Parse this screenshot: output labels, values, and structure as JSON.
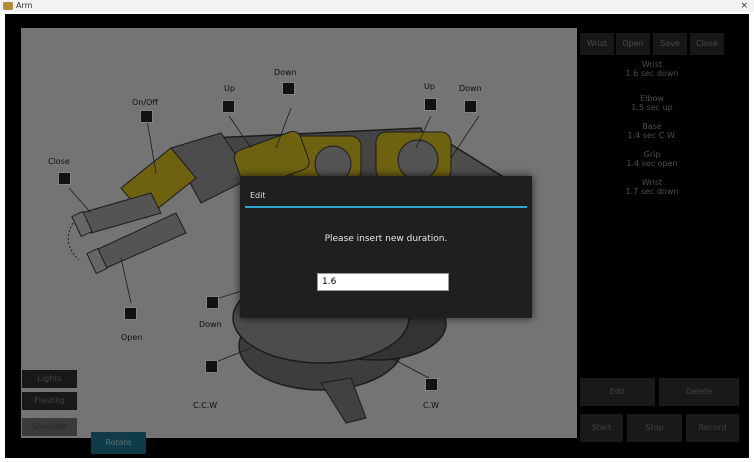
{
  "window": {
    "title": "Arm",
    "close_glyph": "×"
  },
  "diagram": {
    "callouts": [
      {
        "label": "On/Off"
      },
      {
        "label": "Up"
      },
      {
        "label": "Down"
      },
      {
        "label": "Up"
      },
      {
        "label": "Down"
      },
      {
        "label": "Close"
      },
      {
        "label": "Open"
      },
      {
        "label": "Down"
      },
      {
        "label": "C.C.W"
      },
      {
        "label": "C.W"
      }
    ]
  },
  "dialog": {
    "title": "Edit",
    "message": "Please insert new duration.",
    "input_value": "1.6"
  },
  "right_panel": {
    "top_buttons": [
      "Wrist",
      "Open",
      "Save",
      "Close"
    ],
    "sequence": [
      {
        "line1": "Wrist",
        "line2": "1.6 sec down"
      },
      {
        "line1": "Elbow",
        "line2": "1.5 sec up"
      },
      {
        "line1": "Base",
        "line2": "1.4 sec C.W."
      },
      {
        "line1": "Grip",
        "line2": "1.4 sec open"
      },
      {
        "line1": "Wrist",
        "line2": "1.7 sec down"
      }
    ],
    "bottom_buttons": [
      "Edit",
      "Delete",
      "Start",
      "Stop",
      "Record"
    ]
  },
  "left_buttons": [
    "Lights",
    "Flashlig",
    "Shoulder"
  ],
  "rotate_label": "Rotate"
}
